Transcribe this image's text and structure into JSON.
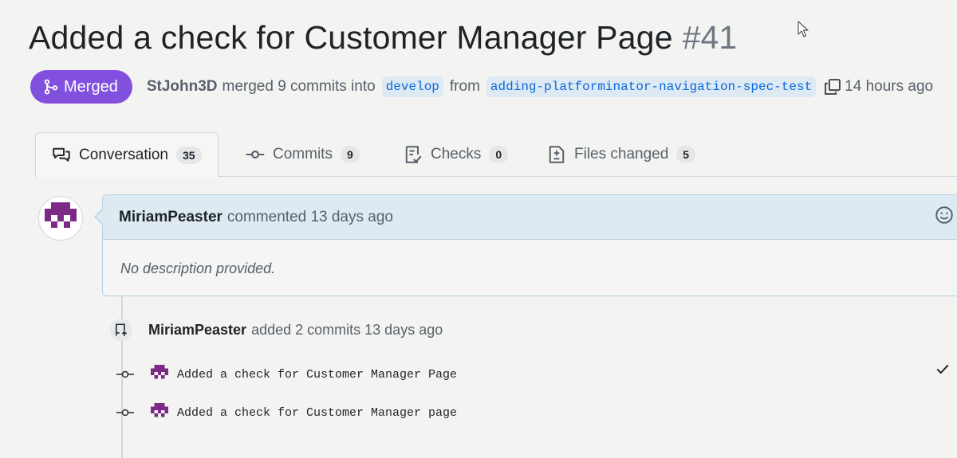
{
  "pr": {
    "title": "Added a check for Customer Manager Page",
    "number": "#41",
    "state": "Merged",
    "author": "StJohn3D",
    "merge_text": "merged 9 commits into",
    "base_branch": "develop",
    "from_text": "from",
    "head_branch": "adding-platforminator-navigation-spec-test",
    "time": "14 hours ago"
  },
  "tabs": [
    {
      "label": "Conversation",
      "count": "35",
      "icon": "conversation-icon"
    },
    {
      "label": "Commits",
      "count": "9",
      "icon": "commit-icon"
    },
    {
      "label": "Checks",
      "count": "0",
      "icon": "checklist-icon"
    },
    {
      "label": "Files changed",
      "count": "5",
      "icon": "file-diff-icon"
    }
  ],
  "comment": {
    "author": "MiriamPeaster",
    "action": "commented 13 days ago",
    "body": "No description provided."
  },
  "event": {
    "author": "MiriamPeaster",
    "action": "added 2 commits 13 days ago"
  },
  "commits": [
    {
      "message": "Added a check for Customer Manager Page"
    },
    {
      "message": "Added a check for Customer Manager page"
    }
  ],
  "colors": {
    "merged": "#8250df",
    "accent_link": "#0969da",
    "avatar": "#7b2a86"
  }
}
